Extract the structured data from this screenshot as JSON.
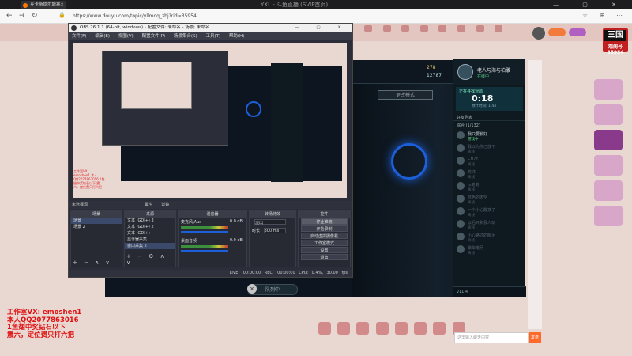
{
  "browser": {
    "tab_title": "乡卡斯提尔城塞",
    "window_title": "YXL - 斗鱼直播 (SVIP首页)",
    "url": "https://www.douyu.com/topic/yllmoq_zbj?rid=35954"
  },
  "douyu": {
    "room_number": "35954",
    "badge_title": "三国",
    "badge_sub": "观阁号"
  },
  "obs": {
    "title": "OBS 26.1.1 (64-bit, windows) - 配置文件: 未命名 - 场景: 未命名",
    "menu": [
      "文件(F)",
      "编辑(E)",
      "视图(V)",
      "配置文件(P)",
      "场景集合(S)",
      "工具(T)",
      "帮助(H)"
    ],
    "scene_bar_label": "未选择源",
    "scene_bar_check": "属性",
    "scene_bar_filter": "滤镜",
    "preview_red_text": "工作室VX: emoshen1 本人QQ2077863016 1鱼翅中奖钻石以下 震六，定位费只打六把",
    "docks": {
      "scenes_title": "场景",
      "scenes": [
        "场景",
        "场景 2"
      ],
      "sources_title": "来源",
      "sources": [
        "文本 (GDI+) 3",
        "文本 (GDI+) 2",
        "文本 (GDI+)",
        "显示器采集",
        "窗口采集 2"
      ],
      "mixer_title": "混音器",
      "mixer": [
        {
          "name": "麦克风/Aux",
          "db": "0.0 dB"
        },
        {
          "name": "桌面音频",
          "db": "0.0 dB"
        }
      ],
      "transitions_title": "转场特效",
      "transition_type": "淡出",
      "transition_duration_label": "时长",
      "transition_duration": "300 ms",
      "controls_title": "控件",
      "controls": [
        "停止推流",
        "开始录制",
        "启动虚拟摄像机",
        "工作室模式",
        "设置",
        "退出"
      ]
    },
    "status": "LIVE: 00:00:00   REC: 00:00:00   CPU: 0.4%, 30.00 fps"
  },
  "game": {
    "gold": "278",
    "blue_essence": "12787",
    "mode_button": "更改模式",
    "queue_button": "队列中"
  },
  "friend_panel": {
    "name": "老人与海与柏雕",
    "status": "在线中",
    "timer_label": "正在寻找对局",
    "timer": "0:18",
    "timer_sub": "预计时间: 1:44",
    "toolbar_label": "好友列表",
    "group_label": "综合 (1/132)",
    "friends": [
      {
        "name": "我只要躺好",
        "status": "游戏中",
        "online": true
      },
      {
        "name": "我以为你已放下",
        "status": "离线",
        "online": false
      },
      {
        "name": "CH7Y",
        "status": "离线",
        "online": false
      },
      {
        "name": "苏沐",
        "status": "离线",
        "online": false
      },
      {
        "name": "lu弟弟",
        "status": "离线",
        "online": false
      },
      {
        "name": "蓝色的天空",
        "status": "离线",
        "online": false
      },
      {
        "name": "一个小心酸孩子",
        "status": "离线",
        "online": false
      },
      {
        "name": "以后只和我人玩",
        "status": "离线",
        "online": false
      },
      {
        "name": "小心路过的眼泪",
        "status": "离线",
        "online": false
      },
      {
        "name": "繁华落尽",
        "status": "离线",
        "online": false
      }
    ],
    "bottom_label": "v11.4"
  },
  "promo": {
    "lines": [
      "工作室VX: emoshen1",
      "本人QQ2077863016",
      "1鱼翅中奖钻石以下",
      "震六，定位费只打六把"
    ]
  },
  "chat": {
    "placeholder": "这里输入聊天内容",
    "send": "发送"
  },
  "colors": {
    "douyu_bg": "#e9d7d2",
    "obs_bg": "#2b2e38",
    "lol_blue": "#1c5fd8",
    "promo_red": "#e01010"
  }
}
